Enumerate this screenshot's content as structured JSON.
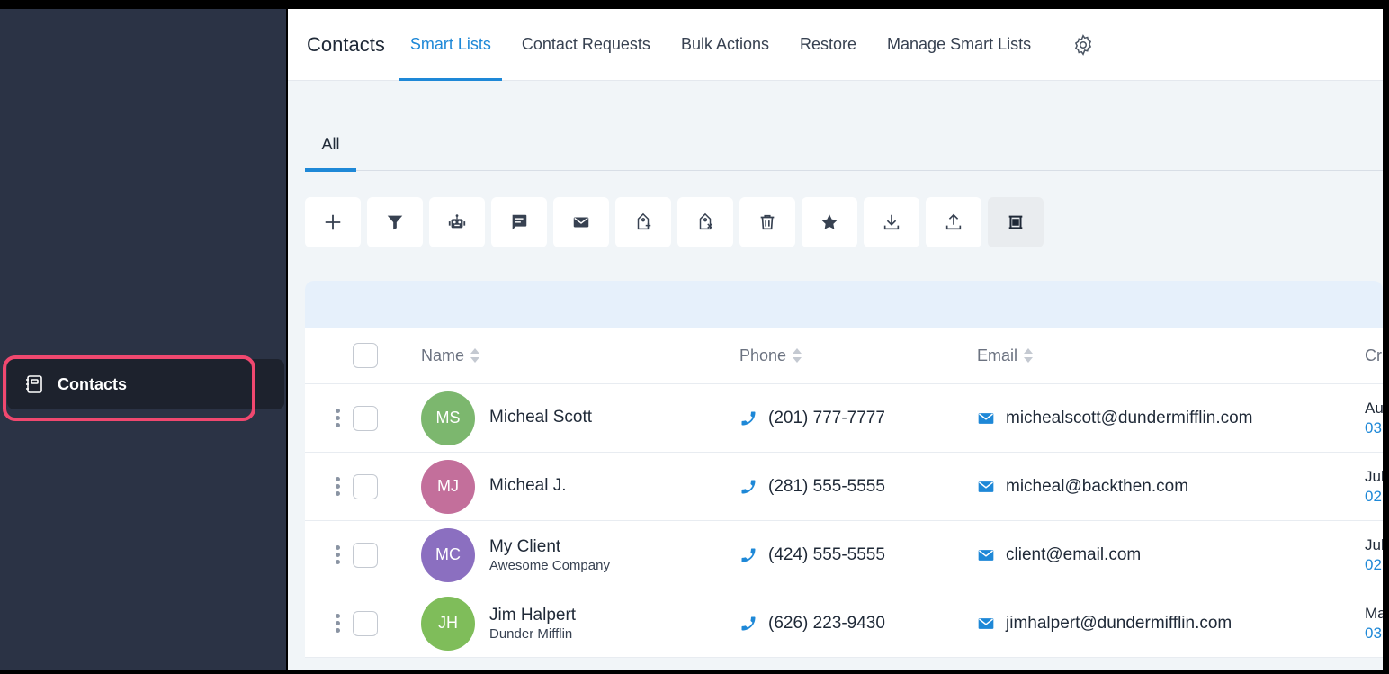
{
  "sidebar": {
    "active_item": {
      "label": "Contacts",
      "icon": "contacts-book-icon"
    }
  },
  "header": {
    "title": "Contacts",
    "tabs": [
      {
        "label": "Smart Lists",
        "active": true
      },
      {
        "label": "Contact Requests"
      },
      {
        "label": "Bulk Actions"
      },
      {
        "label": "Restore"
      },
      {
        "label": "Manage Smart Lists"
      }
    ],
    "settings_icon": "gear-icon"
  },
  "subtabs": [
    {
      "label": "All"
    }
  ],
  "toolbar": [
    {
      "name": "add",
      "icon": "plus-icon"
    },
    {
      "name": "filter",
      "icon": "filter-icon"
    },
    {
      "name": "automation",
      "icon": "robot-icon"
    },
    {
      "name": "sms",
      "icon": "message-icon"
    },
    {
      "name": "email",
      "icon": "envelope-icon"
    },
    {
      "name": "add-tag",
      "icon": "tag-add-icon"
    },
    {
      "name": "remove-tag",
      "icon": "tag-remove-icon"
    },
    {
      "name": "delete",
      "icon": "trash-icon"
    },
    {
      "name": "review",
      "icon": "star-icon"
    },
    {
      "name": "import",
      "icon": "download-icon"
    },
    {
      "name": "export",
      "icon": "upload-icon"
    },
    {
      "name": "merge",
      "icon": "merge-icon"
    }
  ],
  "table": {
    "columns": [
      "Name",
      "Phone",
      "Email",
      "Cr"
    ],
    "rows": [
      {
        "initials": "MS",
        "color": "#7cb76e",
        "name": "Micheal Scott",
        "company": "",
        "phone": "(201) 777-7777",
        "email": "michealscott@dundermifflin.com",
        "created_1": "Au",
        "created_2": "03"
      },
      {
        "initials": "MJ",
        "color": "#c36f9b",
        "name": "Micheal J.",
        "company": "",
        "phone": "(281) 555-5555",
        "email": "micheal@backthen.com",
        "created_1": "Jul",
        "created_2": "02"
      },
      {
        "initials": "MC",
        "color": "#8b6fc0",
        "name": "My Client",
        "company": "Awesome Company",
        "phone": "(424) 555-5555",
        "email": "client@email.com",
        "created_1": "Jul",
        "created_2": "02"
      },
      {
        "initials": "JH",
        "color": "#7fbd5a",
        "name": "Jim Halpert",
        "company": "Dunder Mifflin",
        "phone": "(626) 223-9430",
        "email": "jimhalpert@dundermifflin.com",
        "created_1": "Ma",
        "created_2": "03"
      }
    ]
  },
  "colors": {
    "accent": "#1e88d7",
    "sidebar": "#2b3345",
    "highlight": "#f0486f"
  }
}
